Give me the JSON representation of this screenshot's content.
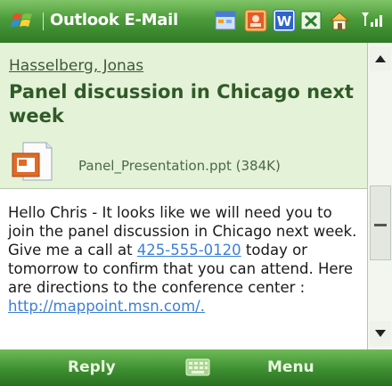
{
  "title_bar": {
    "app_title": "Outlook E-Mail",
    "icons": [
      "windows-start-icon",
      "calendar-icon",
      "contacts-icon",
      "word-icon",
      "excel-icon",
      "home-icon",
      "signal-icon"
    ]
  },
  "message": {
    "sender": "Hasselberg, Jonas",
    "subject": "Panel discussion in Chicago next week",
    "attachment": {
      "label": "Panel_Presentation.ppt (384K)",
      "icon": "powerpoint-file-icon"
    },
    "body": {
      "text_1": "Hello Chris - It looks like we will need you to join the panel discussion in Chicago next week. Give me a call at ",
      "phone": "425-555-0120",
      "text_2": " today or tomorrow to confirm that you can attend. Here are directions to the conference center : ",
      "link": "http://mappoint.msn.com/."
    }
  },
  "soft_keys": {
    "left": "Reply",
    "center_icon": "keyboard-icon",
    "right": "Menu"
  },
  "colors": {
    "header_bg": "#e4f2d8",
    "bar_green": "#4b9b3a",
    "link_blue": "#3c7fd6"
  }
}
